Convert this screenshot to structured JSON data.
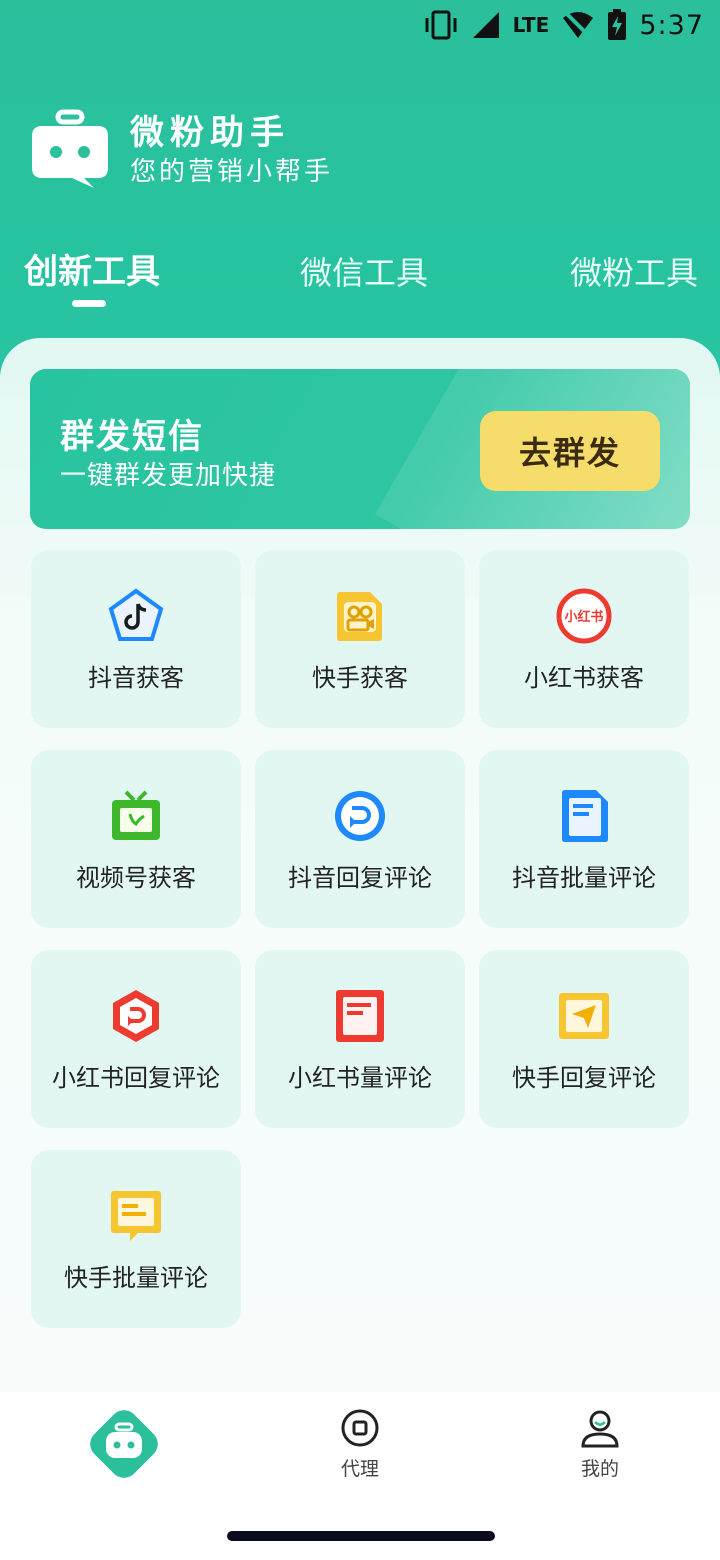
{
  "status_bar": {
    "network": "LTE",
    "time": "5:37"
  },
  "app": {
    "title": "微粉助手",
    "subtitle": "您的营销小帮手"
  },
  "tabs": [
    {
      "label": "创新工具",
      "active": true
    },
    {
      "label": "微信工具",
      "active": false
    },
    {
      "label": "微粉工具",
      "active": false
    }
  ],
  "banner": {
    "title": "群发短信",
    "subtitle": "一键群发更加快捷",
    "button": "去群发"
  },
  "tools": [
    {
      "label": "抖音获客",
      "icon": "douyin-pentagon-icon"
    },
    {
      "label": "快手获客",
      "icon": "kuaishou-icon"
    },
    {
      "label": "小红书获客",
      "icon": "xiaohongshu-icon",
      "icon_text": "小红书"
    },
    {
      "label": "视频号获客",
      "icon": "tv-icon"
    },
    {
      "label": "抖音回复评论",
      "icon": "reply-circle-icon"
    },
    {
      "label": "抖音批量评论",
      "icon": "document-icon"
    },
    {
      "label": "小红书回复评论",
      "icon": "reply-hexagon-icon"
    },
    {
      "label": "小红书量评论",
      "icon": "list-document-icon"
    },
    {
      "label": "快手回复评论",
      "icon": "send-icon"
    },
    {
      "label": "快手批量评论",
      "icon": "comment-icon"
    }
  ],
  "bottom_nav": [
    {
      "label": "",
      "icon": "robot-home-icon",
      "active": true
    },
    {
      "label": "代理",
      "icon": "agent-icon",
      "active": false
    },
    {
      "label": "我的",
      "icon": "profile-icon",
      "active": false
    }
  ],
  "colors": {
    "primary": "#2bbf9c",
    "accent_button": "#f5dc6b",
    "tile_bg": "#e3f7f2"
  }
}
